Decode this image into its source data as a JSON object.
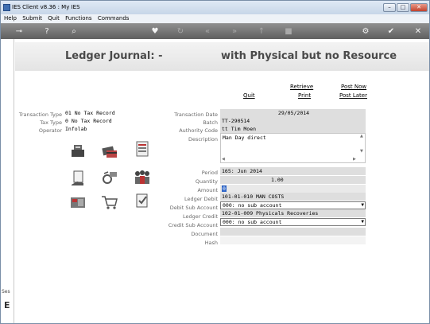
{
  "window": {
    "title": "IES Client v8.36 : My IES",
    "min": "–",
    "max": "□",
    "close": "✕"
  },
  "menu": [
    "Help",
    "Submit",
    "Quit",
    "Functions",
    "Commands"
  ],
  "header": {
    "title_left": "Ledger Journal: -",
    "title_right": "with Physical but no Resource"
  },
  "actions": {
    "quit": "Quit",
    "retrieve": "Retrieve",
    "print": "Print",
    "post_now": "Post Now",
    "post_later": "Post Later"
  },
  "left_info": {
    "transaction_type_label": "Transaction Type",
    "transaction_type": "01 No Tax Record",
    "tax_type_label": "Tax Type",
    "tax_type": "0 No Tax Record",
    "operator_label": "Operator",
    "operator": "Infolab"
  },
  "form": {
    "transaction_date_label": "Transaction Date",
    "transaction_date": "29/05/2014",
    "batch_label": "Batch",
    "batch": "TT-290514",
    "authority_code_label": "Authority Code",
    "authority_code": "tt Tim Moen",
    "description_label": "Description",
    "description": "Man Day direct",
    "period_label": "Period",
    "period": "165: Jun 2014",
    "quantity_label": "Quantity",
    "quantity": "1.00",
    "amount_label": "Amount",
    "amount": "0",
    "ledger_debit_label": "Ledger Debit",
    "ledger_debit": "101-01-010 MAN COSTS",
    "debit_sub_label": "Debit Sub Account",
    "debit_sub": "000: no sub account",
    "ledger_credit_label": "Ledger Credit",
    "ledger_credit": "102-01-009 Physicals Recoveries",
    "credit_sub_label": "Credit Sub Account",
    "credit_sub": "000: no sub account",
    "document_label": "Document",
    "document": "",
    "hash_label": "Hash",
    "hash": ""
  },
  "sidebar": {
    "label": "Ses",
    "glyph": "E"
  }
}
